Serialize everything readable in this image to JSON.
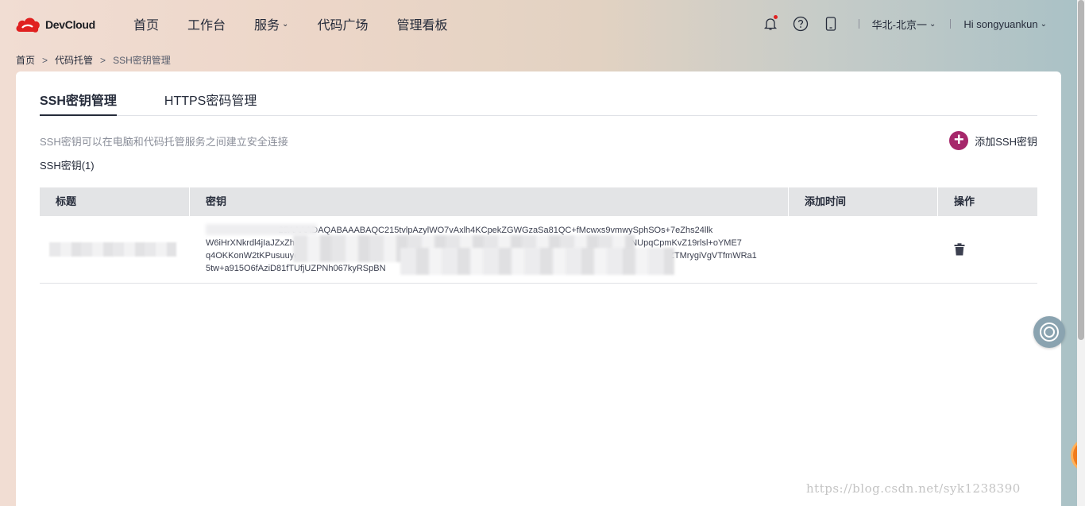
{
  "brand": {
    "name": "DevCloud",
    "accent": "#e02020"
  },
  "nav": [
    {
      "label": "首页",
      "dropdown": false
    },
    {
      "label": "工作台",
      "dropdown": false
    },
    {
      "label": "服务",
      "dropdown": true
    },
    {
      "label": "代码广场",
      "dropdown": false
    },
    {
      "label": "管理看板",
      "dropdown": false
    }
  ],
  "header": {
    "icons": [
      "bell-icon",
      "help-icon",
      "mobile-icon"
    ],
    "region": "华北-北京一",
    "user": "Hi songyuankun"
  },
  "breadcrumb": [
    "首页",
    "代码托管",
    "SSH密钥管理"
  ],
  "tabs": [
    {
      "label": "SSH密钥管理",
      "active": true
    },
    {
      "label": "HTTPS密码管理",
      "active": false
    }
  ],
  "description": "SSH密钥可以在电脑和代码托管服务之间建立安全连接",
  "count_label": "SSH密钥(1)",
  "add_button": {
    "label": "添加SSH密钥",
    "color": "#a6276b"
  },
  "table": {
    "headers": [
      "标题",
      "密钥",
      "添加时间",
      "操作"
    ],
    "rows": [
      {
        "title": "",
        "key_lines": [
          "                              25AAAADAQABAAABAQC215tvlpAzylWO7vAxlh4KCpekZGWGzaSa81QC+fMcwxs9vmwySphSOs+7eZhs24llk",
          "W6iHrXNkrdl4jIaJZxZh                                                                                    fry                     QWeFTxtjzNUewcNUpqCpmKvZ19rlsl+oYME7",
          "q4OKKonW2tKPusuuyeJNWc9K/wOoeMIRy                                                                                                                  u/DZTMrygiVgVTfmWRa1",
          "5tw+a915O6fAziD81fTUfjUZPNh067kyRSpBN"
        ],
        "added_time": ""
      }
    ]
  },
  "watermark": "https://blog.csdn.net/syk1238390"
}
